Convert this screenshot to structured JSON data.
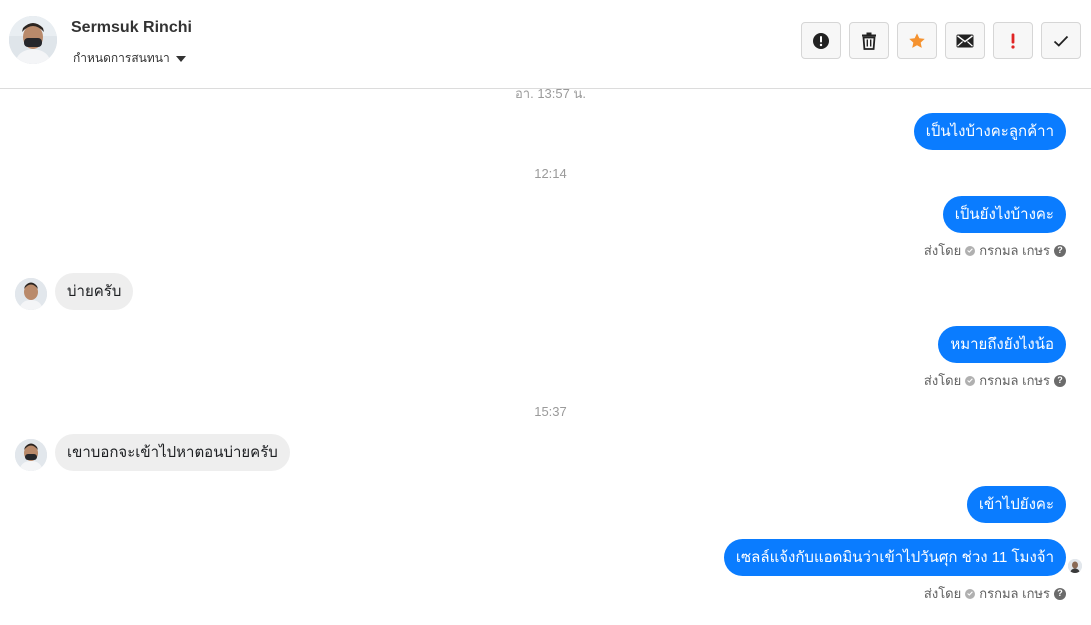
{
  "header": {
    "contact_name": "Sermsuk Rinchi",
    "assign_label": "กำหนดการสนทนา",
    "toolbar": [
      {
        "icon": "alert-circle-icon",
        "name": "spam-button"
      },
      {
        "icon": "trash-icon",
        "name": "delete-button"
      },
      {
        "icon": "star-icon",
        "name": "star-button",
        "color": "#f5922f"
      },
      {
        "icon": "envelope-icon",
        "name": "mark-unread-button"
      },
      {
        "icon": "exclamation-icon",
        "name": "important-button",
        "color": "#e02424"
      },
      {
        "icon": "check-icon",
        "name": "done-button"
      }
    ]
  },
  "chat": {
    "partial_timestamp": "อา. 13:57 น.",
    "timestamps": [
      "12:14",
      "15:37"
    ],
    "messages": [
      {
        "direction": "out",
        "text": "เป็นไงบ้างคะลูกค้าา"
      },
      {
        "direction": "out",
        "text": "เป็นยังไงบ้างคะ"
      },
      {
        "direction": "in",
        "text": "บ่ายครับ"
      },
      {
        "direction": "out",
        "text": "หมายถึงยังไงน้อ"
      },
      {
        "direction": "in",
        "text": "เขาบอกจะเข้าไปหาตอนบ่ายครับ"
      },
      {
        "direction": "out",
        "text": "เข้าไปยังคะ"
      },
      {
        "direction": "out",
        "text": "เซลล์แจ้งกับแอดมินว่าเข้าไปวันศุก ช่วง 11 โมงจ้า"
      }
    ],
    "sent_by_prefix": "ส่งโดย",
    "sent_by_name": "กรกมล เกษร"
  },
  "colors": {
    "outgoing_bubble": "#0a7cff",
    "incoming_bubble": "#eeeeee",
    "timestamp": "#9a9a9a",
    "star": "#f5922f",
    "exclamation": "#e02424"
  }
}
